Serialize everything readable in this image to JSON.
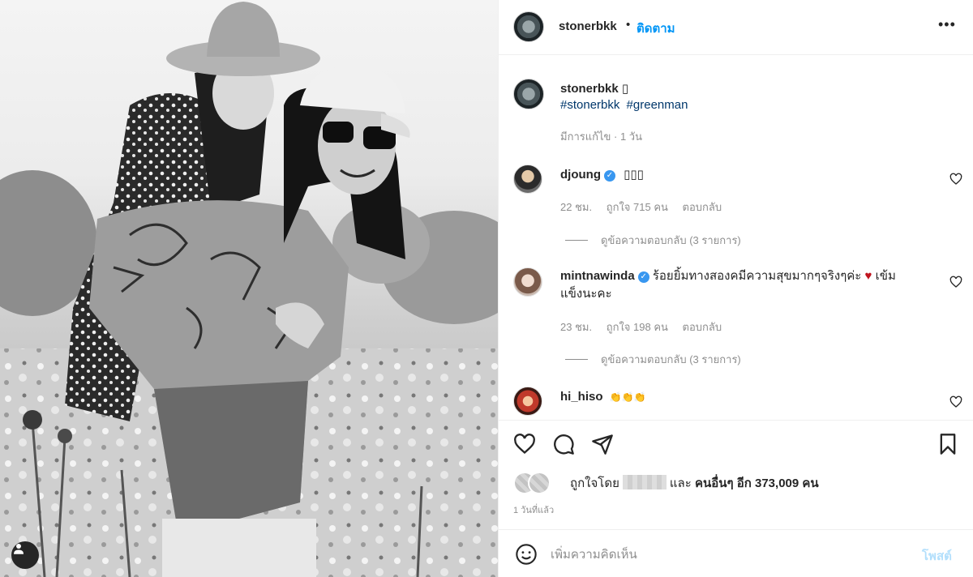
{
  "post": {
    "username": "stonerbkk",
    "dot": "•",
    "follow_label": "ติดตาม",
    "more_label": "•••"
  },
  "caption": {
    "username": "stonerbkk",
    "box_glyph": "▯",
    "hashtags": [
      "#stonerbkk",
      "#greenman"
    ],
    "meta": "มีการแก้ไข · 1 วัน"
  },
  "comments": [
    {
      "username": "djoung",
      "verified": true,
      "text": "▯▯▯",
      "time": "22 ชม.",
      "likes": "ถูกใจ 715 คน",
      "reply_label": "ตอบกลับ",
      "view_replies": "ดูข้อความตอบกลับ (3 รายการ)"
    },
    {
      "username": "mintnawinda",
      "verified": true,
      "text_before_heart": "ร้อยยิ้มทางสองคมีความสุขมากๆจริงๆค่ะ",
      "heart": "♥",
      "text_after_heart": "เข้ม",
      "text_line2": "แข็งนะคะ",
      "time": "23 ชม.",
      "likes": "ถูกใจ 198 คน",
      "reply_label": "ตอบกลับ",
      "view_replies": "ดูข้อความตอบกลับ (3 รายการ)"
    },
    {
      "username": "hi_hiso",
      "verified": false,
      "text": "👏👏👏"
    }
  ],
  "likes": {
    "prefix": "ถูกใจโดย",
    "and": "และ",
    "others_bold": "คนอื่นๆ อีก 373,009 คน"
  },
  "time_ago": "1 วันที่แล้ว",
  "comment_box": {
    "placeholder": "เพิ่มความคิดเห็น",
    "post_label": "โพสต์"
  },
  "colors": {
    "accent": "#0095f6",
    "hashtag": "#00376b",
    "muted": "#8e8e8e",
    "verified": "#3897f0",
    "heart": "#ed4956"
  },
  "icons": {
    "like": "heart-outline-icon",
    "comment": "speech-bubble-icon",
    "share": "paper-plane-icon",
    "save": "bookmark-icon",
    "emoji": "smiley-icon",
    "tag": "person-tag-icon"
  }
}
